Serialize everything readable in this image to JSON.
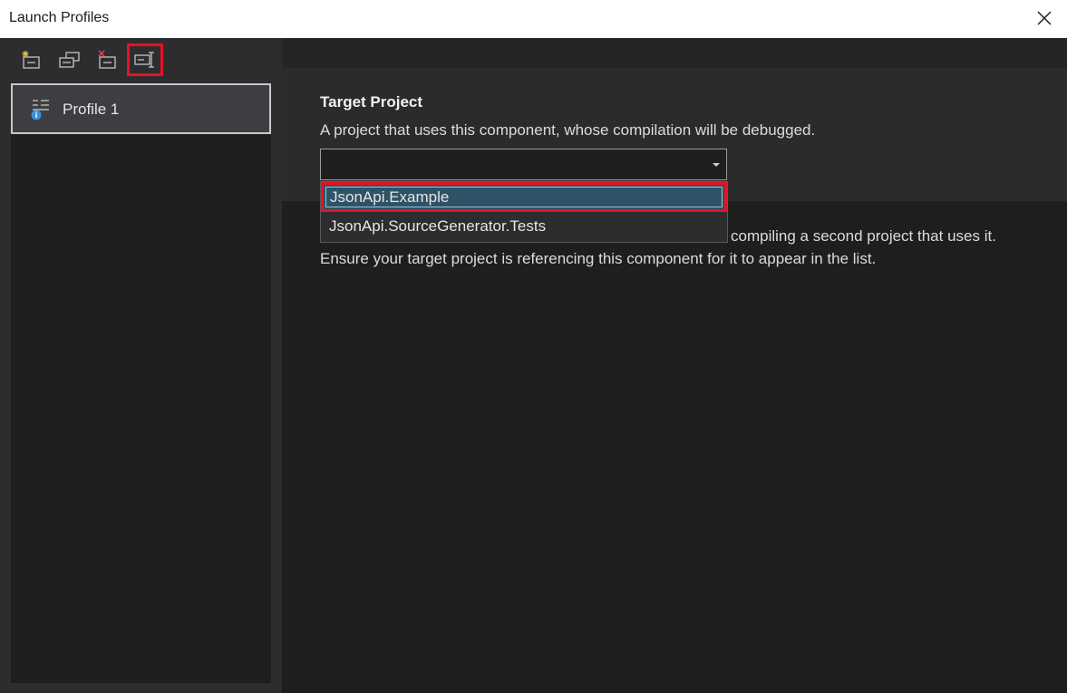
{
  "window": {
    "title": "Launch Profiles",
    "close_icon": "close-icon"
  },
  "toolbar": {
    "buttons": [
      {
        "name": "new-profile-icon",
        "highlighted": false
      },
      {
        "name": "copy-profile-icon",
        "highlighted": false
      },
      {
        "name": "delete-profile-icon",
        "highlighted": false
      },
      {
        "name": "rename-profile-icon",
        "highlighted": true
      }
    ]
  },
  "profiles": {
    "items": [
      {
        "label": "Profile 1",
        "icon": "profile-settings-icon",
        "selected": true
      }
    ]
  },
  "target_project": {
    "heading": "Target Project",
    "description": "A project that uses this component, whose compilation will be debugged.",
    "select_value": "",
    "help_text_fragment": "compiling a second project that uses it. Ensure your target project is referencing this component for it to appear in the list.",
    "options": [
      {
        "label": "JsonApi.Example",
        "highlighted": true
      },
      {
        "label": "JsonApi.SourceGenerator.Tests",
        "highlighted": false
      }
    ]
  },
  "colors": {
    "accent_highlight": "#e81123",
    "selected_option_bg": "#2e5266",
    "info_badge": "#3b8de0"
  }
}
